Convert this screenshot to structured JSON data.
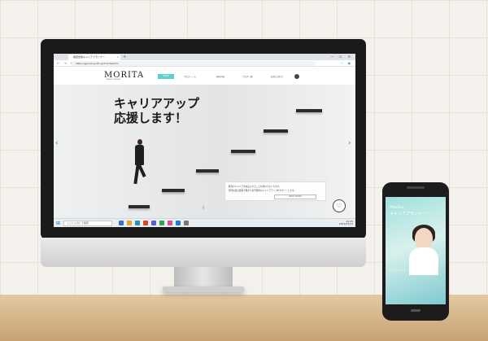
{
  "browser": {
    "tab_title": "森田志保キャリアプランナー",
    "tab_close": "×",
    "new_tab": "+",
    "window_controls": "─ ☐ ✕",
    "nav_controls": "← → ⟳",
    "url": "https://gp.hokuyodo.jp/moritashiho",
    "extension_icons": "☆ ◉"
  },
  "site": {
    "logo": "MORITA",
    "logo_sub": "CAREER PLANNER",
    "nav": {
      "active": "HOME",
      "items": [
        "プロフィール",
        "研修内容",
        "ブログ一覧",
        "お問い合わせ"
      ]
    }
  },
  "hero": {
    "title_line1": "キャリアアップ",
    "title_line2": "応援します！",
    "arrow_left": "‹",
    "arrow_right": "›",
    "scroll_icon": "⇩",
    "info_line1": "経営のキャリアを充実させることを重ねてまいります。",
    "info_line2": "現代社会の要求で繋がり専門研修のキャリアアップをサポートします。",
    "read_more": "READ MORE",
    "badge_icon": "♡"
  },
  "taskbar": {
    "start_icon": "⊞",
    "search_placeholder": "ここに入力して検索",
    "tray_time": "12:25",
    "tray_date": "2021/07/14"
  },
  "phone": {
    "title1": "Morita",
    "title2": "キャリアプランナー",
    "caption": "キャリアプランナー 森田志保",
    "arrow": "‹"
  }
}
